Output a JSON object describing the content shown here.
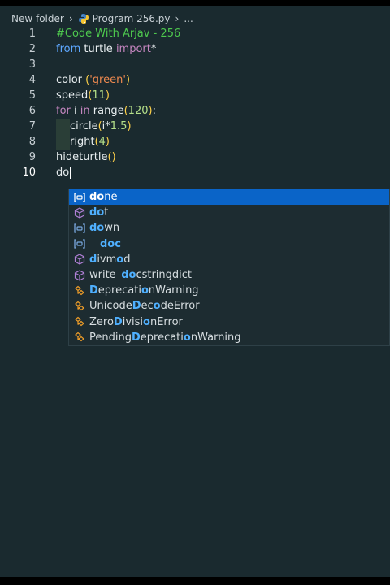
{
  "breadcrumb": {
    "folder": "New folder",
    "file": "Program 256.py",
    "more": "..."
  },
  "lines": [
    {
      "num": "1"
    },
    {
      "num": "2"
    },
    {
      "num": "3"
    },
    {
      "num": "4"
    },
    {
      "num": "5"
    },
    {
      "num": "6"
    },
    {
      "num": "7"
    },
    {
      "num": "8"
    },
    {
      "num": "9"
    },
    {
      "num": "10"
    }
  ],
  "code": {
    "l1": "#Code With Arjav - 256",
    "l2_kw1": "from",
    "l2_mod": "turtle",
    "l2_kw2": "import",
    "l2_star": "*",
    "l4_fn": "color",
    "l4_str": "'green'",
    "l5_fn": "speed",
    "l5_num": "11",
    "l6_for": "for",
    "l6_i": "i",
    "l6_in": "in",
    "l6_fn": "range",
    "l6_num": "120",
    "l6_colon": ":",
    "l7_fn": "circle",
    "l7_arg": "i*",
    "l7_num": "1.5",
    "l8_fn": "right",
    "l8_num": "4",
    "l9_fn": "hideturtle",
    "l10": "do"
  },
  "suggestions": [
    {
      "pre": "",
      "hl": "do",
      "post": "ne",
      "icon": "variable-icon",
      "kind": "var"
    },
    {
      "pre": "",
      "hl": "do",
      "post": "t",
      "icon": "cube-icon",
      "kind": "fn"
    },
    {
      "pre": "",
      "hl": "do",
      "post": "wn",
      "icon": "variable-icon",
      "kind": "var"
    },
    {
      "pre": "__",
      "hl": "doc",
      "post": "__",
      "icon": "variable-icon",
      "kind": "var"
    },
    {
      "pre": "",
      "hl": "d",
      "post": "ivm",
      "hl2": "o",
      "post2": "d",
      "icon": "cube-icon",
      "kind": "fn"
    },
    {
      "pre": "write_",
      "hl": "do",
      "post": "cstringdict",
      "icon": "cube-icon",
      "kind": "fn"
    },
    {
      "pre": "",
      "hl": "D",
      "post": "eprecati",
      "hl2": "o",
      "post2": "nWarning",
      "icon": "class-icon",
      "kind": "class"
    },
    {
      "pre": "Unicode",
      "hl": "D",
      "post": "ec",
      "hl2": "o",
      "post2": "deError",
      "icon": "class-icon",
      "kind": "class"
    },
    {
      "pre": "Zero",
      "hl": "D",
      "post": "ivisi",
      "hl2": "o",
      "post2": "nError",
      "icon": "class-icon",
      "kind": "class"
    },
    {
      "pre": "Pending",
      "hl": "D",
      "post": "eprecati",
      "hl2": "o",
      "post2": "nWarning",
      "icon": "class-icon",
      "kind": "class"
    }
  ],
  "colors": {
    "selection": "#0a64c8",
    "background": "#1a2a2f",
    "match": "#4fb0ff"
  }
}
